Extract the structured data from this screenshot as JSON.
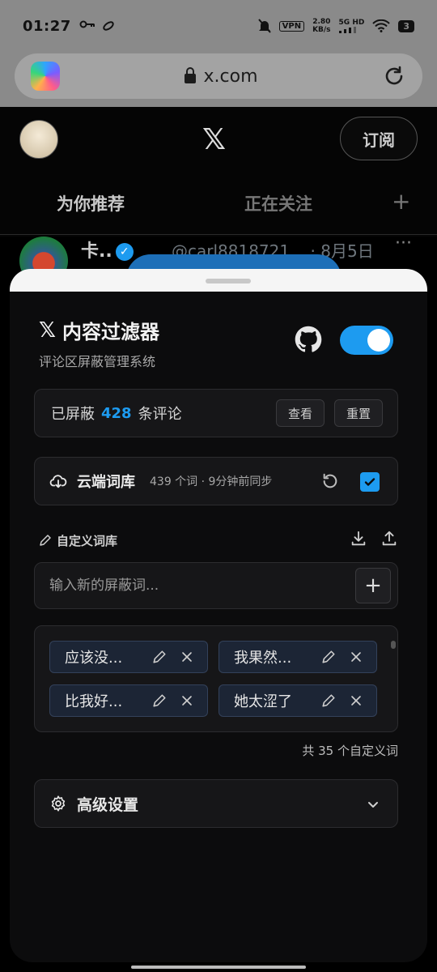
{
  "status_bar": {
    "time": "01:27",
    "vpn": "VPN",
    "speed_value": "2.80",
    "speed_unit": "KB/s",
    "network": "5G HD",
    "battery": "3"
  },
  "browser": {
    "url": "x.com"
  },
  "x_page": {
    "logo": "𝕏",
    "subscribe_label": "订阅",
    "tabs": [
      {
        "label": "为你推荐"
      },
      {
        "label": "正在关注"
      }
    ],
    "tab_add": "+",
    "tweet": {
      "name": "卡..",
      "handle": "@carl8818721...",
      "date": "· 8月5日",
      "more": "···"
    }
  },
  "panel": {
    "title_mark": "𝕏",
    "title": "内容过滤器",
    "subtitle": "评论区屏蔽管理系统",
    "enabled": true,
    "blocked": {
      "prefix": "已屏蔽",
      "count": "428",
      "suffix": "条评论",
      "view_label": "查看",
      "reset_label": "重置"
    },
    "cloud": {
      "label": "云端词库",
      "meta": "439 个词 · 9分钟前同步",
      "checked": true
    },
    "custom": {
      "heading": "自定义词库",
      "input_placeholder": "输入新的屏蔽词...",
      "add_label": "+",
      "words": [
        {
          "text": "应该没..."
        },
        {
          "text": "我果然..."
        },
        {
          "text": "比我好..."
        },
        {
          "text": "她太涩了"
        }
      ],
      "total": "共 35 个自定义词"
    },
    "advanced": {
      "label": "高级设置"
    }
  },
  "colors": {
    "accent": "#1d9bf0",
    "sheet_bg": "#0c0c0d",
    "card_bg": "#161618",
    "chip_bg": "#1c2535"
  }
}
